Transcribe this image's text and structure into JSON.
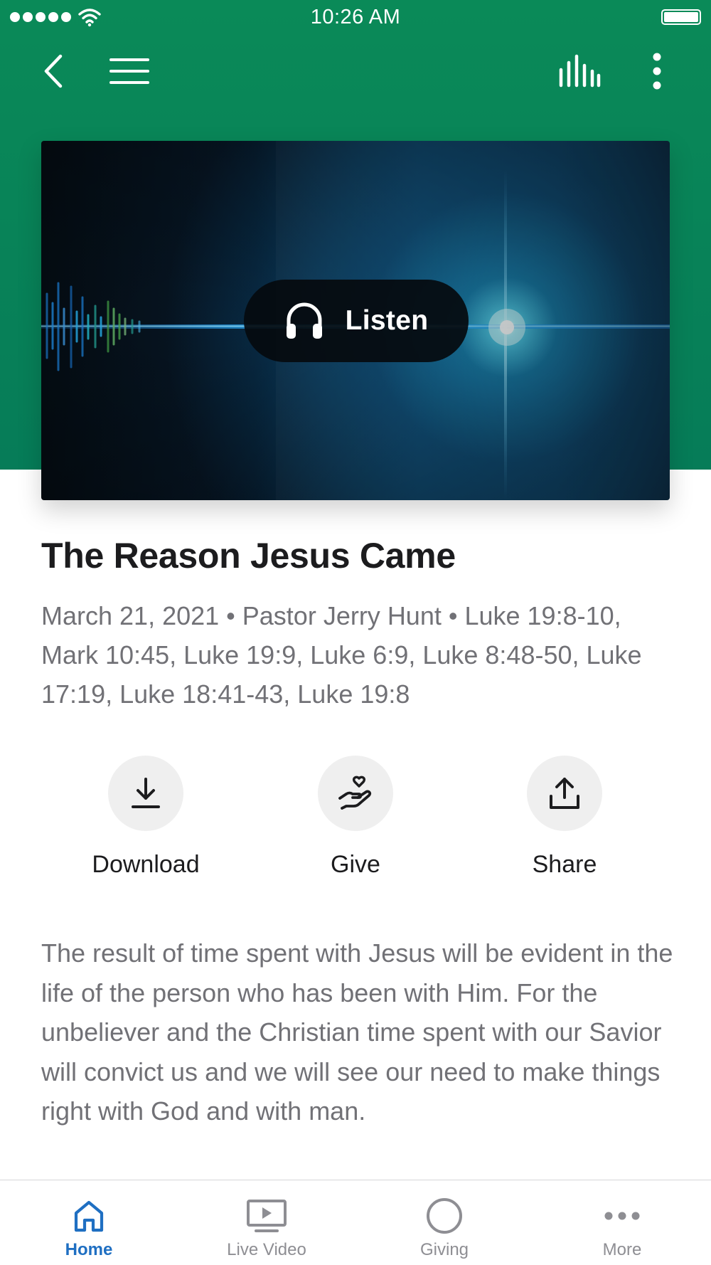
{
  "status_bar": {
    "time": "10:26 AM"
  },
  "header": {
    "icons": [
      "chevron-left-icon",
      "hamburger-menu-icon",
      "audio-bars-icon",
      "vertical-dots-icon"
    ]
  },
  "media": {
    "listen_label": "Listen",
    "listen_icon": "headphones-icon"
  },
  "sermon": {
    "title": "The Reason Jesus Came",
    "date": "March 21, 2021",
    "speaker": "Pastor Jerry Hunt",
    "scripture": "Luke 19:8-10, Mark 10:45, Luke 19:9, Luke 6:9, Luke 8:48-50, Luke 17:19, Luke 18:41-43, Luke 19:8",
    "separator": "•",
    "description": "The result of time spent with Jesus will be evident in the life of the person who has been with Him. For the unbeliever and the Christian time spent with our Savior will convict us and we will see our need to make things right with God and with man."
  },
  "actions": [
    {
      "label": "Download",
      "icon": "download-icon"
    },
    {
      "label": "Give",
      "icon": "give-hand-heart-icon"
    },
    {
      "label": "Share",
      "icon": "share-icon"
    }
  ],
  "tabs": [
    {
      "label": "Home",
      "icon": "home-icon",
      "active": true
    },
    {
      "label": "Live Video",
      "icon": "live-video-icon",
      "active": false
    },
    {
      "label": "Giving",
      "icon": "giving-circle-icon",
      "active": false
    },
    {
      "label": "More",
      "icon": "more-dots-icon",
      "active": false
    }
  ],
  "colors": {
    "header_green": "#0a8a58",
    "active_tab": "#1f6fc2",
    "inactive_tab": "#8e8e93",
    "secondary_text": "#717176"
  }
}
